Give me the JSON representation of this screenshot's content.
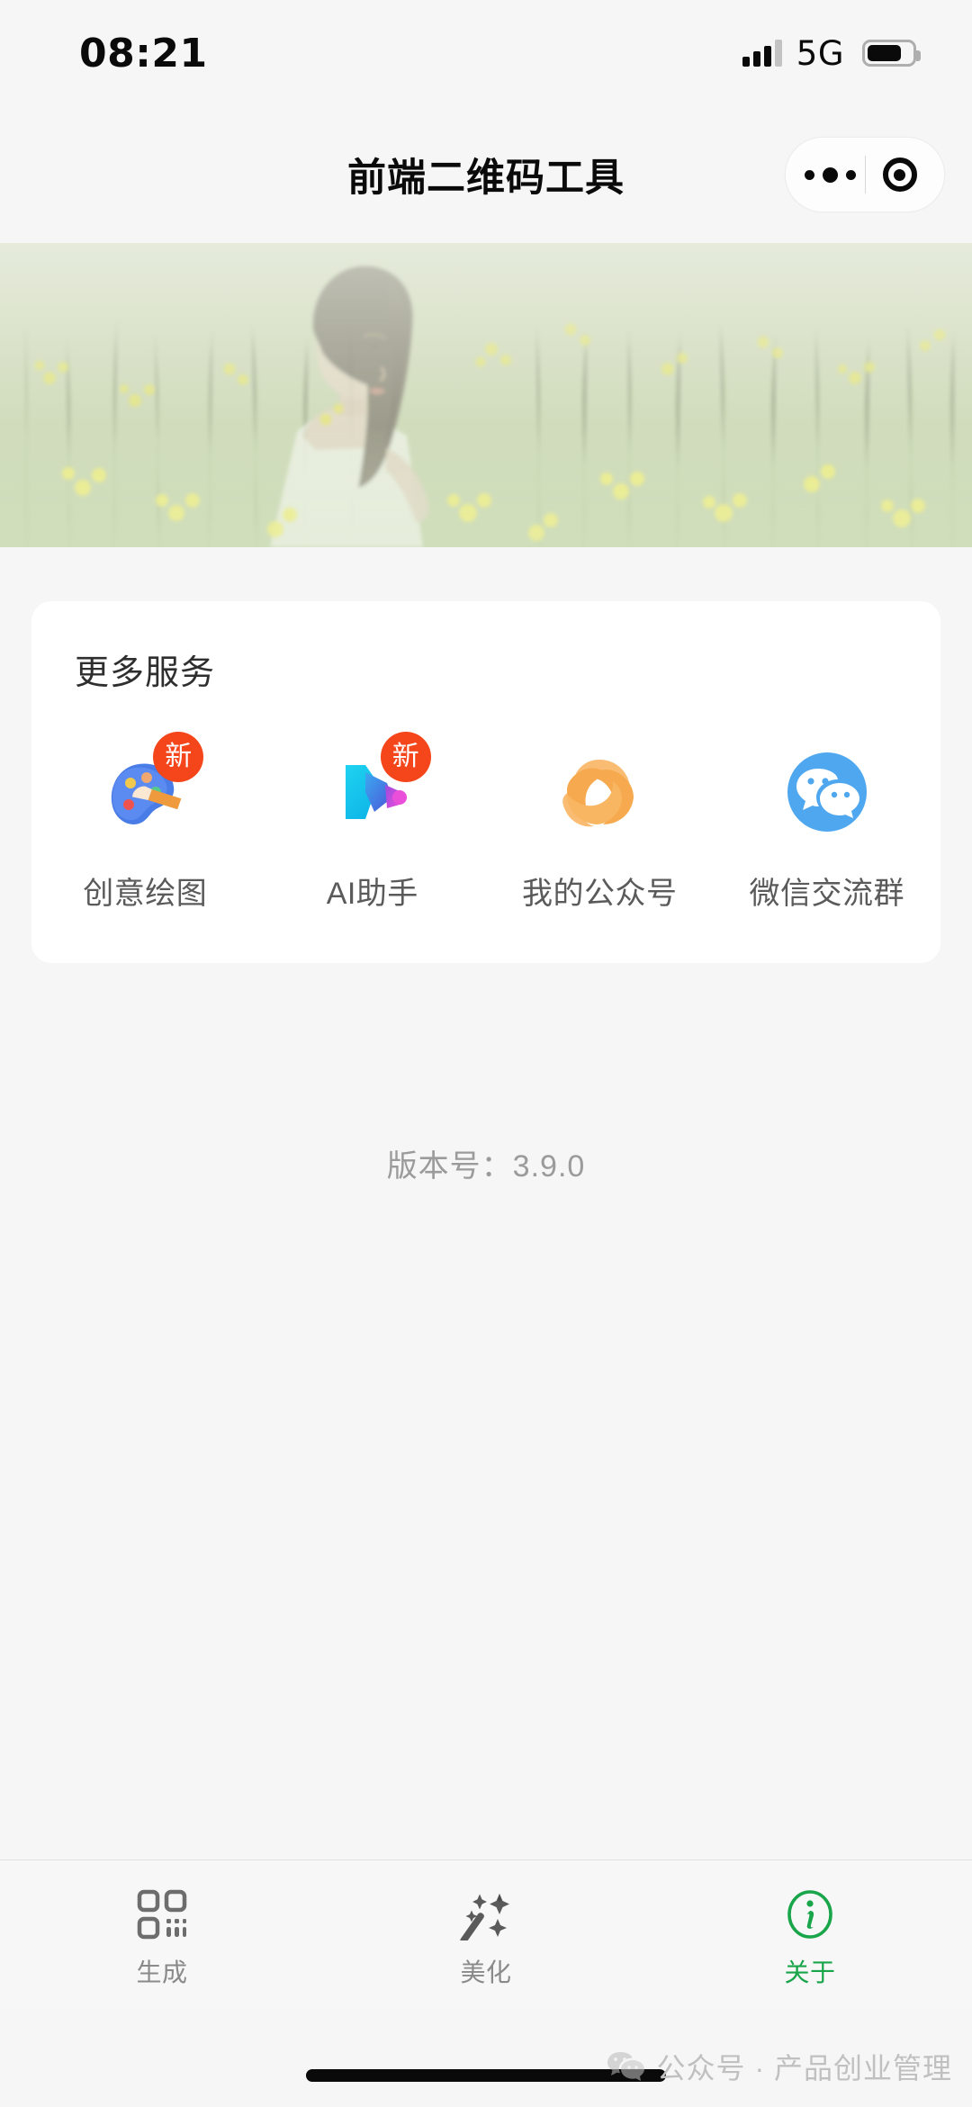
{
  "status_bar": {
    "time": "08:21",
    "network": "5G",
    "signal_icon": "signal-bars-icon",
    "battery_icon": "battery-icon",
    "battery_level_percent": 78
  },
  "nav": {
    "title": "前端二维码工具",
    "capsule": {
      "menu_icon": "more-dots-icon",
      "target_icon": "target-circle-icon"
    }
  },
  "banner": {
    "alt": "woman-in-rapeseed-flower-field-banner",
    "name": "hero-banner-image"
  },
  "services_card": {
    "title": "更多服务",
    "items": [
      {
        "label": "创意绘图",
        "icon": "art-palette-icon",
        "badge": "新",
        "has_badge": true
      },
      {
        "label": "AI助手",
        "icon": "ai-assistant-icon",
        "badge": "新",
        "has_badge": true
      },
      {
        "label": "我的公众号",
        "icon": "official-account-swirl-icon",
        "badge": "",
        "has_badge": false
      },
      {
        "label": "微信交流群",
        "icon": "wechat-group-icon",
        "badge": "",
        "has_badge": false
      }
    ]
  },
  "version_text": "版本号：3.9.0",
  "tabbar": {
    "tabs": [
      {
        "label": "生成",
        "icon": "qrcode-icon",
        "active": false
      },
      {
        "label": "美化",
        "icon": "magic-wand-sparkle-icon",
        "active": false
      },
      {
        "label": "关于",
        "icon": "info-circle-icon",
        "active": true
      }
    ]
  },
  "watermark": {
    "icon": "wechat-logo-icon",
    "text": "公众号 · 产品创业管理"
  },
  "colors": {
    "page_background": "#f6f6f6",
    "card_background": "#ffffff",
    "badge_red": "#f5451b",
    "active_green": "#19a54a",
    "label_gray": "#5a5a5a",
    "muted_gray": "#9b9b9b",
    "wechat_blue": "#4fa7ef",
    "swirl_orange": "#f7a854"
  }
}
